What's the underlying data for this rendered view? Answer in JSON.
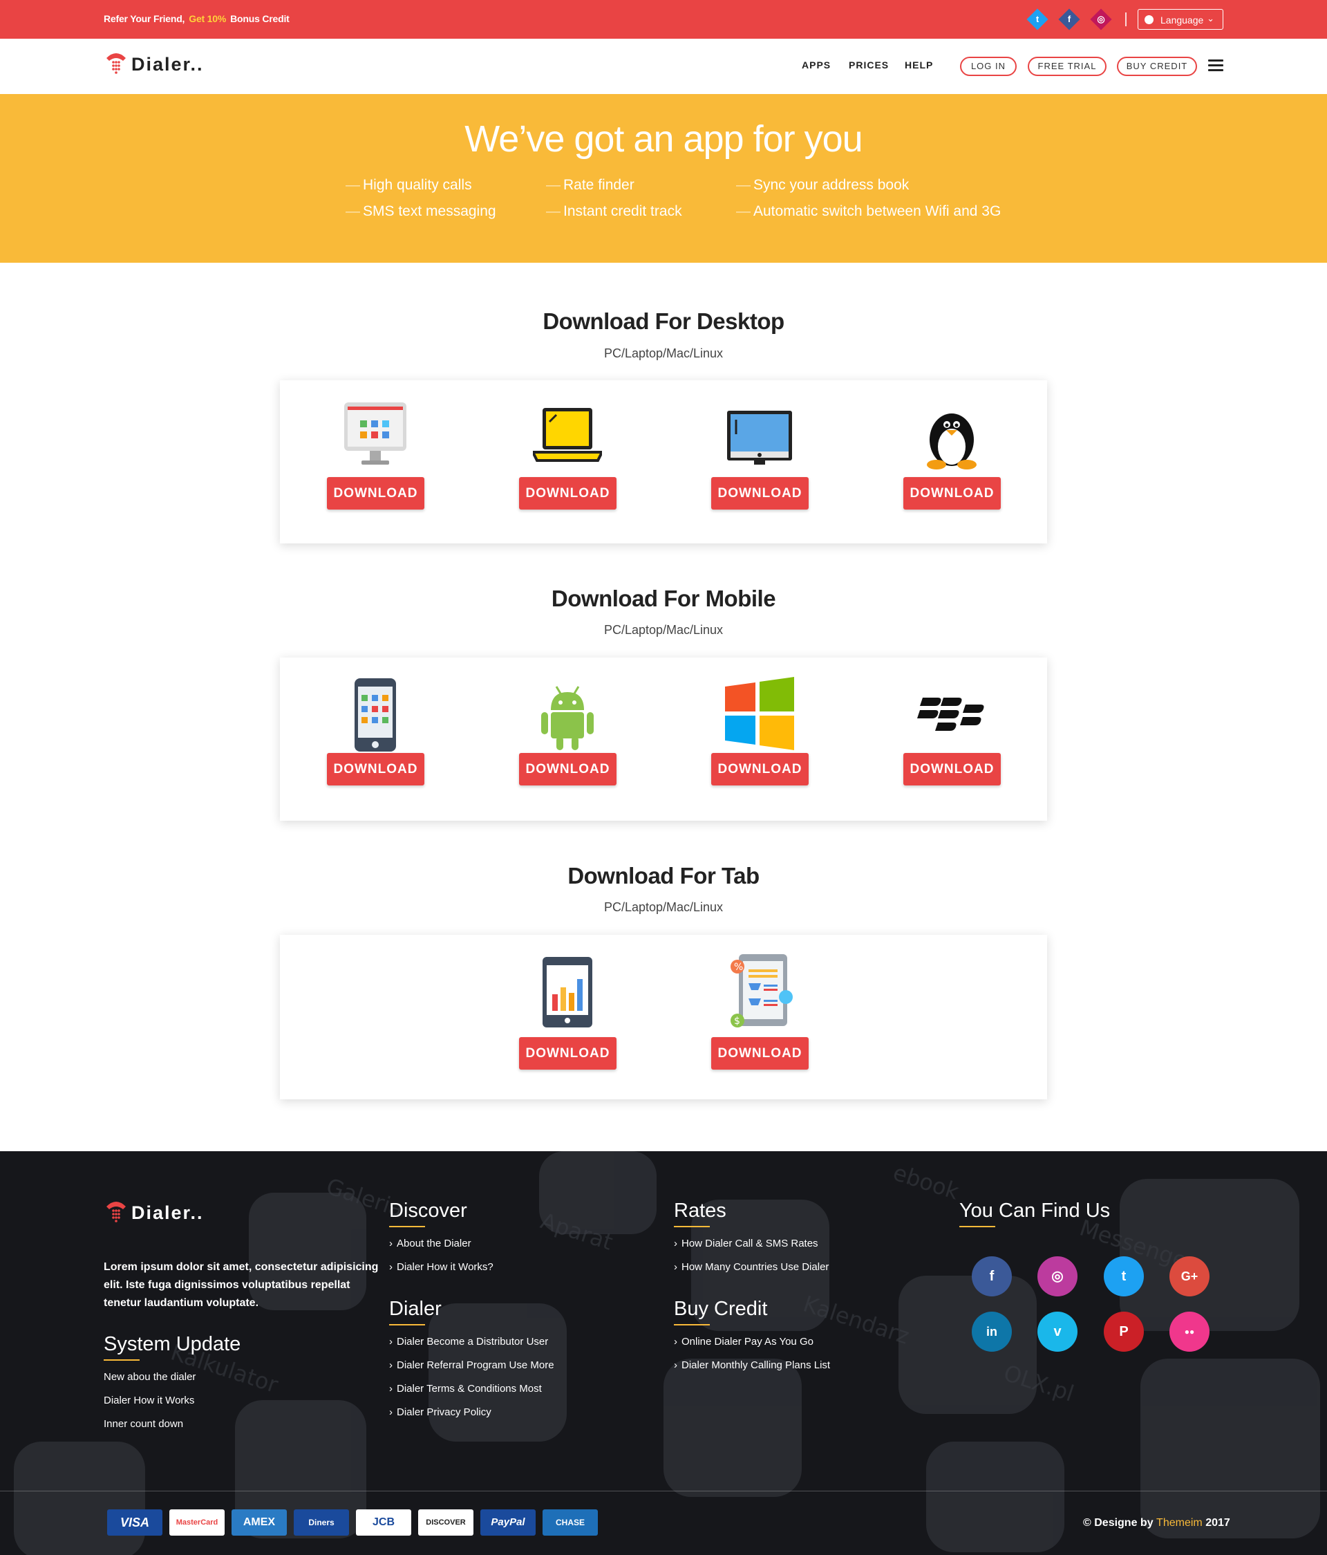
{
  "topbar": {
    "promo_start": "Refer Your Friend,",
    "promo_highlight": "Get 10%",
    "promo_end": "Bonus Credit",
    "social": [
      {
        "icon": "twitter-icon",
        "glyph": "t",
        "color": "#1da1f2"
      },
      {
        "icon": "facebook-icon",
        "glyph": "f",
        "color": "#3b5998"
      },
      {
        "icon": "instagram-icon",
        "glyph": "◎",
        "color": "#c1175a"
      }
    ],
    "language_label": "Language"
  },
  "nav": {
    "logo_text": "Dialer..",
    "menu": [
      "APPS",
      "PRICES",
      "HELP"
    ],
    "login": "LOG IN",
    "trial": "FREE TRIAL",
    "buy": "BUY CREDIT"
  },
  "hero": {
    "title": "We’ve got an app for you",
    "features": [
      "High quality calls",
      "Rate finder",
      "Sync your address book",
      "SMS text messaging",
      "Instant credit track",
      "Automatic switch between Wifi and 3G"
    ]
  },
  "sections": [
    {
      "title": "Download For Desktop",
      "subtitle": "PC/Laptop/Mac/Linux",
      "items": [
        {
          "icon": "pc-monitor-icon",
          "button": "DOWNLOAD"
        },
        {
          "icon": "laptop-icon",
          "button": "DOWNLOAD"
        },
        {
          "icon": "mac-monitor-icon",
          "button": "DOWNLOAD"
        },
        {
          "icon": "linux-penguin-icon",
          "button": "DOWNLOAD"
        }
      ]
    },
    {
      "title": "Download For Mobile",
      "subtitle": "PC/Laptop/Mac/Linux",
      "items": [
        {
          "icon": "iphone-icon",
          "button": "DOWNLOAD"
        },
        {
          "icon": "android-icon",
          "button": "DOWNLOAD"
        },
        {
          "icon": "windows-icon",
          "button": "DOWNLOAD"
        },
        {
          "icon": "blackberry-icon",
          "button": "DOWNLOAD"
        }
      ]
    },
    {
      "title": "Download For Tab",
      "subtitle": "PC/Laptop/Mac/Linux",
      "items": [
        {
          "icon": "tablet-chart-icon",
          "button": "DOWNLOAD"
        },
        {
          "icon": "tablet-shop-icon",
          "button": "DOWNLOAD"
        }
      ]
    }
  ],
  "footer": {
    "logo_text": "Dialer..",
    "about": "Lorem ipsum dolor sit amet, consectetur adipisicing elit. Iste fuga dignissimos voluptatibus repellat tenetur laudantium voluptate.",
    "system_update": {
      "title": "System Update",
      "links": [
        "New abou the dialer",
        "Dialer How it Works",
        "Inner count down"
      ]
    },
    "discover": {
      "title": "Discover",
      "links": [
        "About the Dialer",
        "Dialer How it Works?"
      ]
    },
    "dialer": {
      "title": "Dialer",
      "links": [
        "Dialer Become a Distributor User",
        "Dialer Referral Program Use More",
        "Dialer Terms & Conditions Most",
        "Dialer Privacy Policy"
      ]
    },
    "rates": {
      "title": "Rates",
      "links": [
        "How Dialer Call & SMS Rates",
        "How Many Countries Use Dialer"
      ]
    },
    "buy_credit": {
      "title": "Buy Credit",
      "links": [
        "Online Dialer Pay As You Go",
        "Dialer Monthly Calling Plans List"
      ]
    },
    "find_us": {
      "title": "You Can Find Us",
      "social": [
        {
          "icon": "facebook-icon",
          "glyph": "f",
          "color": "#3b5998"
        },
        {
          "icon": "instagram-icon",
          "glyph": "◎",
          "color": "#bc3b9e"
        },
        {
          "icon": "twitter-icon",
          "glyph": "t",
          "color": "#1da1f2"
        },
        {
          "icon": "google-plus-icon",
          "glyph": "G+",
          "color": "#dc4b3e"
        },
        {
          "icon": "linkedin-icon",
          "glyph": "in",
          "color": "#0e76a8"
        },
        {
          "icon": "vimeo-icon",
          "glyph": "v",
          "color": "#1ab7ea"
        },
        {
          "icon": "pinterest-icon",
          "glyph": "P",
          "color": "#cb2027"
        },
        {
          "icon": "flickr-icon",
          "glyph": "●●",
          "color": "#f0378c"
        }
      ]
    },
    "payments": [
      {
        "label": "VISA",
        "bg": "#1a4a9c",
        "fg": "#ffffff"
      },
      {
        "label": "MasterCard",
        "bg": "#ffffff",
        "fg": "#e94444"
      },
      {
        "label": "AMEX",
        "bg": "#2a7bc4",
        "fg": "#ffffff"
      },
      {
        "label": "Diners",
        "bg": "#1a4a9c",
        "fg": "#ffffff"
      },
      {
        "label": "JCB",
        "bg": "#ffffff",
        "fg": "#1a4a9c"
      },
      {
        "label": "DISCOVER",
        "bg": "#ffffff",
        "fg": "#222222"
      },
      {
        "label": "PayPal",
        "bg": "#1a4a9c",
        "fg": "#ffffff"
      },
      {
        "label": "CHASE",
        "bg": "#1e6fb8",
        "fg": "#ffffff"
      }
    ],
    "copyright_start": "© Designe by",
    "copyright_brand": "Themeim",
    "copyright_year": "2017"
  }
}
